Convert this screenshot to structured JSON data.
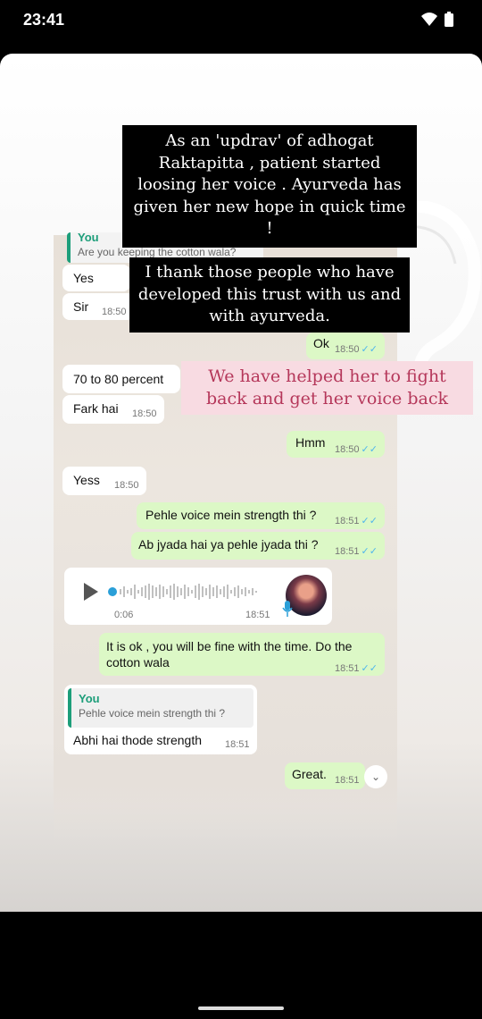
{
  "status": {
    "time": "23:41"
  },
  "overlays": {
    "top_text": "As an 'updrav' of adhogat Raktapitta , patient started loosing her voice . Ayurveda has given her new hope in quick time !",
    "middle_text": "I thank those people who have developed this trust with us and with ayurveda.",
    "pink_text": "We have helped her to fight back and get her voice back"
  },
  "chat": {
    "partial_quote_name": "You",
    "partial_quote_text": "Are you keeping the cotton wala?",
    "messages": [
      {
        "text": "Yes"
      },
      {
        "text": "Sir",
        "time": "18:50"
      },
      {
        "text": "Ok",
        "time": "18:50"
      },
      {
        "text": "70 to 80 percent"
      },
      {
        "text": "Fark hai",
        "time": "18:50"
      },
      {
        "text": "Hmm",
        "time": "18:50"
      },
      {
        "text": "Yess",
        "time": "18:50"
      },
      {
        "text": "Pehle voice mein strength thi ?",
        "time": "18:51"
      },
      {
        "text": "Ab jyada hai ya pehle jyada thi ?",
        "time": "18:51"
      },
      {
        "text": "It is ok , you will be fine with the time. Do the cotton wala",
        "time": "18:51"
      },
      {
        "text": "Abhi hai thode strength",
        "time": "18:51"
      },
      {
        "text": "Great.",
        "time": "18:51"
      }
    ],
    "voice": {
      "duration": "0:06",
      "time": "18:51"
    },
    "reply_quote": {
      "name": "You",
      "text": "Pehle voice mein strength thi ?"
    }
  },
  "icons": [
    "wifi-icon",
    "battery-icon",
    "play-icon",
    "mic-icon",
    "double-check-icon",
    "scroll-down-icon",
    "avatar"
  ]
}
